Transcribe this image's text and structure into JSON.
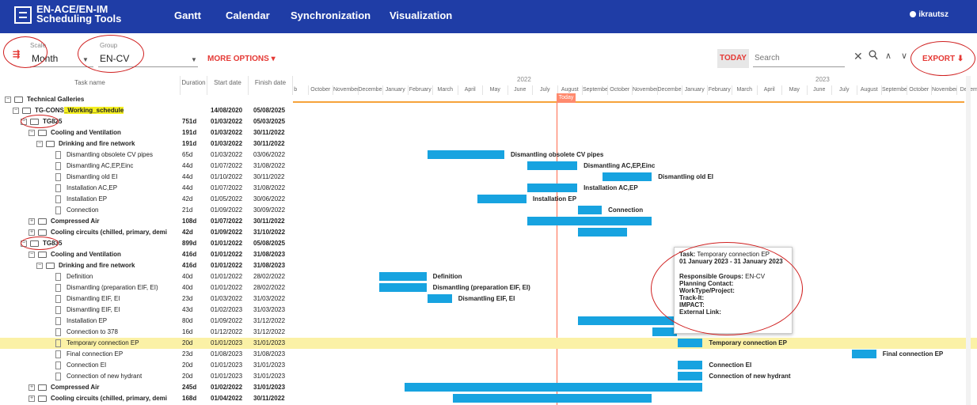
{
  "app": {
    "logo_line1": "EN-ACE/EN-IM",
    "logo_line2": "Scheduling Tools",
    "user": "ikrautsz"
  },
  "nav": [
    "Gantt",
    "Calendar",
    "Synchronization",
    "Visualization"
  ],
  "toolbar": {
    "scale_label": "Scale",
    "scale_value": "Month",
    "group_label": "Group",
    "group_value": "EN-CV",
    "more_options": "MORE OPTIONS",
    "today": "TODAY",
    "search_placeholder": "Search",
    "export": "EXPORT"
  },
  "grid_columns": [
    "Task name",
    "Duration",
    "Start date",
    "Finish date"
  ],
  "timeline": {
    "years": [
      "2022",
      "2023"
    ],
    "months": [
      "b",
      "October",
      "November",
      "December",
      "January",
      "February",
      "March",
      "April",
      "May",
      "June",
      "July",
      "August",
      "September",
      "October",
      "November",
      "December",
      "January",
      "February",
      "March",
      "April",
      "May",
      "June",
      "July",
      "August",
      "September",
      "October",
      "November",
      "Decem"
    ],
    "today_label": "Today"
  },
  "rows": [
    {
      "name": "Technical Galleries",
      "duration": "",
      "start": "",
      "finish": "",
      "bold": true
    },
    {
      "name_pre": "TG-CONS",
      "name_hl": "_Working_schedule",
      "duration": "",
      "start": "14/08/2020",
      "finish": "05/08/2025",
      "bold": true
    },
    {
      "name": "TG825",
      "duration": "751d",
      "start": "01/03/2022",
      "finish": "05/03/2025",
      "bold": true
    },
    {
      "name": "Cooling and Ventilation",
      "duration": "191d",
      "start": "01/03/2022",
      "finish": "30/11/2022",
      "bold": true
    },
    {
      "name": "Drinking and fire network",
      "duration": "191d",
      "start": "01/03/2022",
      "finish": "30/11/2022",
      "bold": true
    },
    {
      "name": "Dismantling obsolete CV pipes",
      "duration": "65d",
      "start": "01/03/2022",
      "finish": "03/06/2022",
      "bold": false,
      "bar_label": "Dismantling obsolete CV pipes"
    },
    {
      "name": "Dismantling AC,EP,Einc",
      "duration": "44d",
      "start": "01/07/2022",
      "finish": "31/08/2022",
      "bold": false,
      "bar_label": "Dismantling AC,EP,Einc"
    },
    {
      "name": "Dismantling old EI",
      "duration": "44d",
      "start": "01/10/2022",
      "finish": "30/11/2022",
      "bold": false,
      "bar_label": "Dismantling old EI"
    },
    {
      "name": "Installation AC,EP",
      "duration": "44d",
      "start": "01/07/2022",
      "finish": "31/08/2022",
      "bold": false,
      "bar_label": "Installation AC,EP"
    },
    {
      "name": "Installation EP",
      "duration": "42d",
      "start": "01/05/2022",
      "finish": "30/06/2022",
      "bold": false,
      "bar_label": "Installation EP"
    },
    {
      "name": "Connection",
      "duration": "21d",
      "start": "01/09/2022",
      "finish": "30/09/2022",
      "bold": false,
      "bar_label": "Connection"
    },
    {
      "name": "Compressed Air",
      "duration": "108d",
      "start": "01/07/2022",
      "finish": "30/11/2022",
      "bold": true
    },
    {
      "name": "Cooling circuits (chilled, primary, demi",
      "duration": "42d",
      "start": "01/09/2022",
      "finish": "31/10/2022",
      "bold": true
    },
    {
      "name": "TG835",
      "duration": "899d",
      "start": "01/01/2022",
      "finish": "05/08/2025",
      "bold": true
    },
    {
      "name": "Cooling and Ventilation",
      "duration": "416d",
      "start": "01/01/2022",
      "finish": "31/08/2023",
      "bold": true
    },
    {
      "name": "Drinking and fire network",
      "duration": "416d",
      "start": "01/01/2022",
      "finish": "31/08/2023",
      "bold": true
    },
    {
      "name": "Definition",
      "duration": "40d",
      "start": "01/01/2022",
      "finish": "28/02/2022",
      "bold": false,
      "bar_label": "Definition"
    },
    {
      "name": "Dismantling (preparation EIF, EI)",
      "duration": "40d",
      "start": "01/01/2022",
      "finish": "28/02/2022",
      "bold": false,
      "bar_label": "Dismantling (preparation EIF, EI)"
    },
    {
      "name": "Dismantling EIF, EI",
      "duration": "23d",
      "start": "01/03/2022",
      "finish": "31/03/2022",
      "bold": false,
      "bar_label": "Dismantling EIF, EI"
    },
    {
      "name": "Dismantling EIF, EI",
      "duration": "43d",
      "start": "01/02/2023",
      "finish": "31/03/2023",
      "bold": false,
      "bar_label": "EIF, EI"
    },
    {
      "name": "Installation EP",
      "duration": "80d",
      "start": "01/09/2022",
      "finish": "31/12/2022",
      "bold": false
    },
    {
      "name": "Connection to 378",
      "duration": "16d",
      "start": "01/12/2022",
      "finish": "31/12/2022",
      "bold": false
    },
    {
      "name": "Temporary connection EP",
      "duration": "20d",
      "start": "01/01/2023",
      "finish": "31/01/2023",
      "bold": false,
      "bar_label": "Temporary connection EP",
      "selected": true
    },
    {
      "name": "Final connection EP",
      "duration": "23d",
      "start": "01/08/2023",
      "finish": "31/08/2023",
      "bold": false,
      "bar_label": "Final connection EP"
    },
    {
      "name": "Connection EI",
      "duration": "20d",
      "start": "01/01/2023",
      "finish": "31/01/2023",
      "bold": false,
      "bar_label": "Connection EI"
    },
    {
      "name": "Connection of new hydrant",
      "duration": "20d",
      "start": "01/01/2023",
      "finish": "31/01/2023",
      "bold": false,
      "bar_label": "Connection of new hydrant"
    },
    {
      "name": "Compressed Air",
      "duration": "245d",
      "start": "01/02/2022",
      "finish": "31/01/2023",
      "bold": true
    },
    {
      "name": "Cooling circuits (chilled, primary, demi",
      "duration": "168d",
      "start": "01/04/2022",
      "finish": "30/11/2022",
      "bold": true
    }
  ],
  "tooltip": {
    "task_label": "Task:",
    "task_value": "Temporary connection EP",
    "dates": "01 January 2023 - 31 January 2023",
    "groups_label": "Responsible Groups:",
    "groups_value": "EN-CV",
    "planning": "Planning Contact:",
    "worktype": "WorkType/Project:",
    "track": "Track-It:",
    "impact": "IMPACT:",
    "external": "External Link:"
  }
}
